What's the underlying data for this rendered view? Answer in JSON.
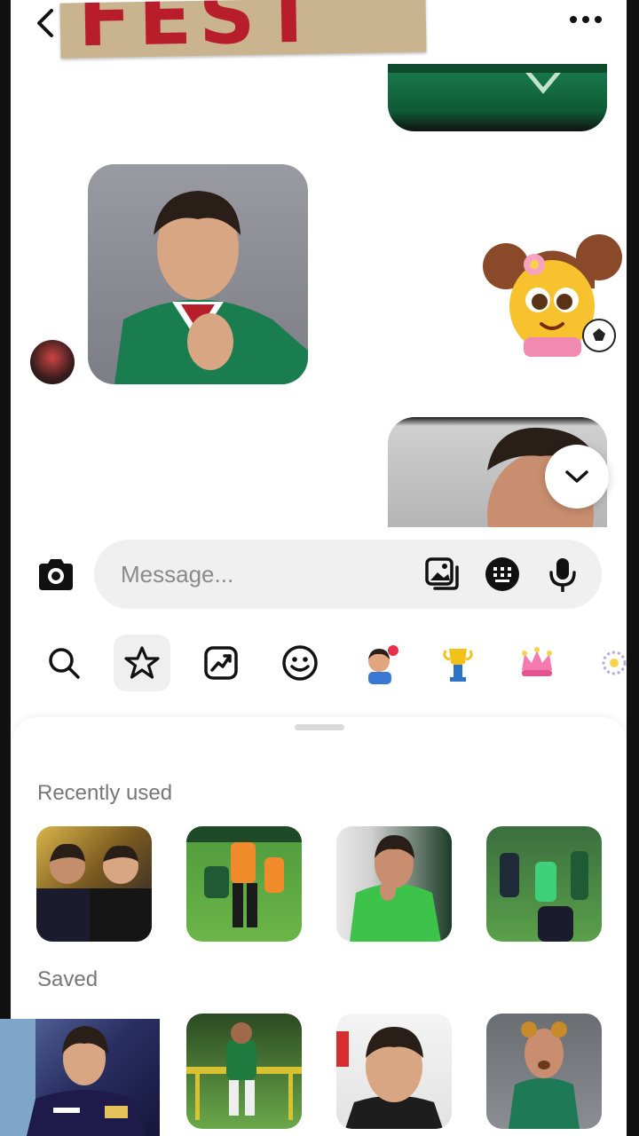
{
  "header": {
    "sticker_text": "FEST",
    "back_icon": "chevron-left-icon",
    "more_icon": "more-horizontal-icon"
  },
  "conversation": {
    "sticker": "emoji-girl-soccer-sticker"
  },
  "composer": {
    "placeholder": "Message...",
    "camera_icon": "camera-icon",
    "gallery_icon": "gallery-icon",
    "keyboard_icon": "keyboard-icon",
    "mic_icon": "microphone-icon"
  },
  "sticker_tabs": [
    {
      "icon": "search-icon"
    },
    {
      "icon": "star-icon",
      "active": true
    },
    {
      "icon": "trending-icon"
    },
    {
      "icon": "smiley-icon"
    },
    {
      "icon": "avatar-sticker-icon"
    },
    {
      "icon": "trophy-sticker-icon"
    },
    {
      "icon": "crown-sticker-icon"
    },
    {
      "icon": "sparkle-sticker-icon"
    }
  ],
  "panel": {
    "recently_used_title": "Recently used",
    "saved_title": "Saved"
  },
  "colors": {
    "accent_red": "#b81d2b",
    "mexico_green": "#1a7d4f",
    "panel_bg": "#ffffff",
    "input_bg": "#f0f0f0"
  }
}
